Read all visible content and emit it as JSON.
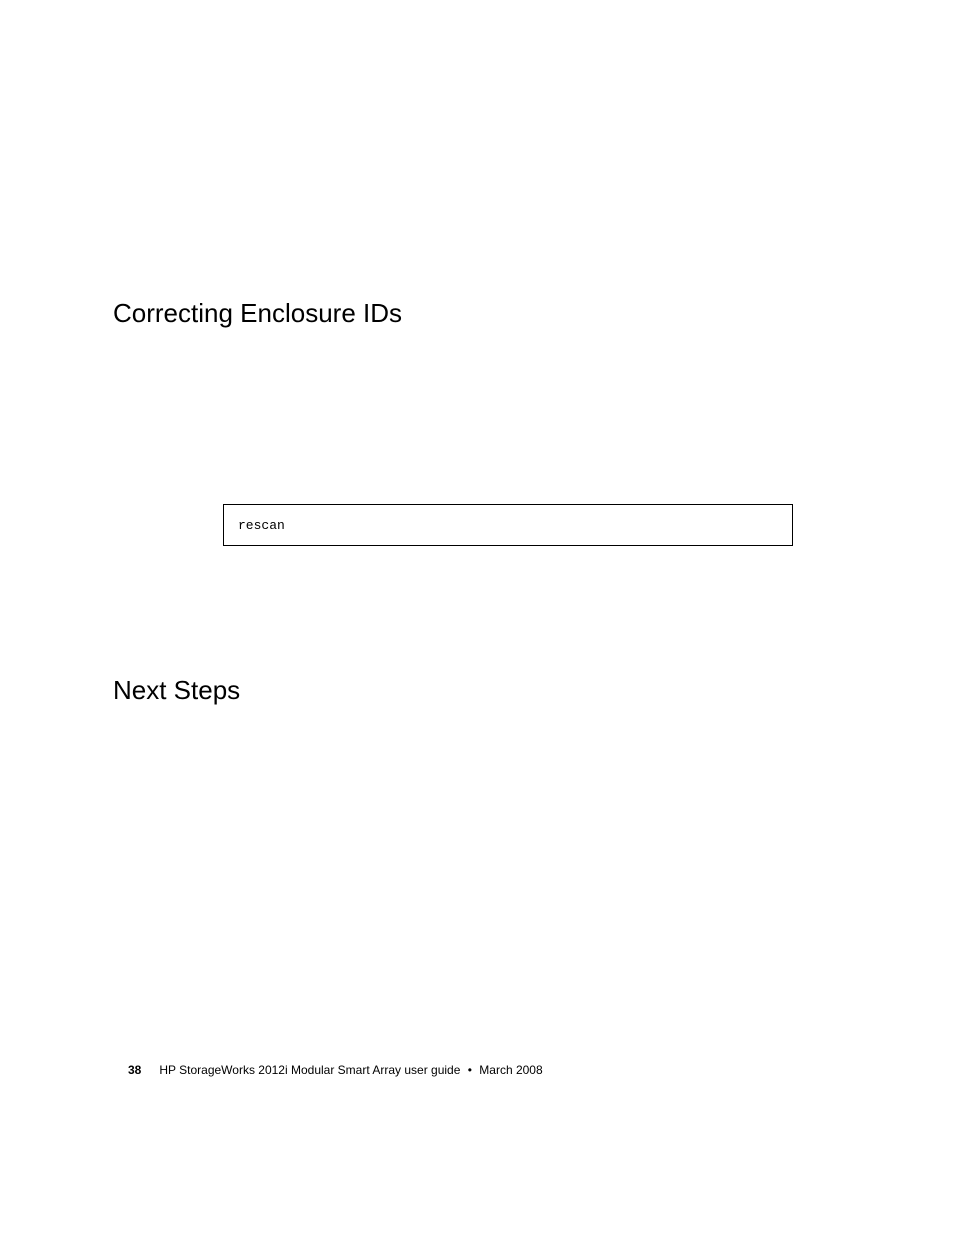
{
  "headings": {
    "h1": "Correcting Enclosure IDs",
    "h2": "Next Steps"
  },
  "code": {
    "command": "rescan"
  },
  "footer": {
    "page_number": "38",
    "title": "HP StorageWorks 2012i Modular Smart Array user guide",
    "bullet": "•",
    "date": "March 2008"
  }
}
